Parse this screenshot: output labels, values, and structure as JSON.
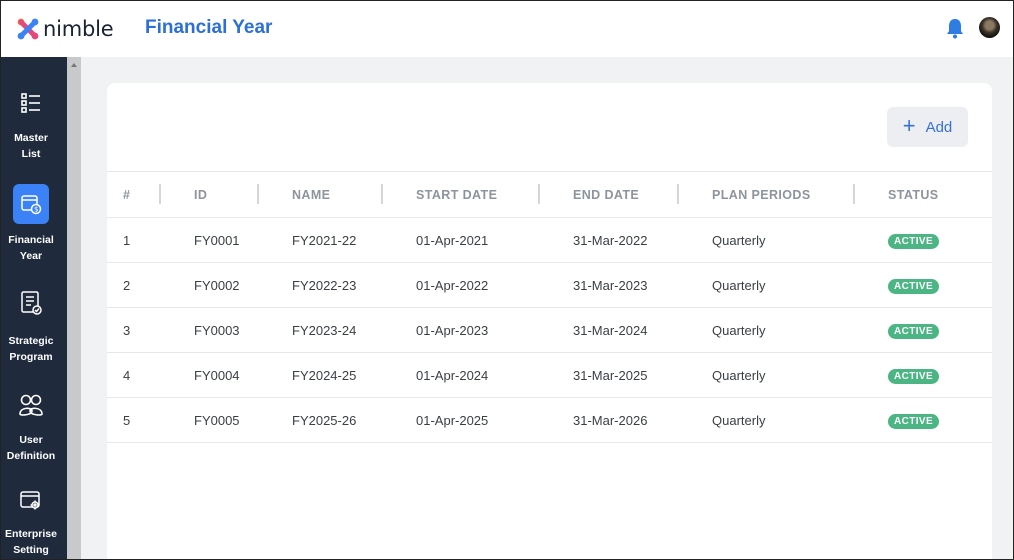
{
  "app": {
    "logo_text": "nimble",
    "page_title": "Financial Year"
  },
  "colors": {
    "accent": "#2c6fd8",
    "sidebar_bg": "#1f2a3d",
    "active_nav": "#3b82f6",
    "status_active": "#4bb584"
  },
  "sidebar": {
    "items": [
      {
        "label_line1": "Master",
        "label_line2": "List",
        "icon": "list-icon"
      },
      {
        "label_line1": "Financial",
        "label_line2": "Year",
        "icon": "calendar-dollar-icon",
        "active": true
      },
      {
        "label_line1": "Strategic",
        "label_line2": "Program",
        "icon": "checklist-icon"
      },
      {
        "label_line1": "User",
        "label_line2": "Definition",
        "icon": "users-icon"
      },
      {
        "label_line1": "Enterprise",
        "label_line2": "Setting",
        "icon": "window-gear-icon"
      }
    ]
  },
  "toolbar": {
    "add_label": "Add"
  },
  "table": {
    "columns": [
      "#",
      "ID",
      "NAME",
      "START DATE",
      "END DATE",
      "PLAN PERIODS",
      "STATUS"
    ],
    "rows": [
      [
        "1",
        "FY0001",
        "FY2021-22",
        "01-Apr-2021",
        "31-Mar-2022",
        "Quarterly",
        "ACTIVE"
      ],
      [
        "2",
        "FY0002",
        "FY2022-23",
        "01-Apr-2022",
        "31-Mar-2023",
        "Quarterly",
        "ACTIVE"
      ],
      [
        "3",
        "FY0003",
        "FY2023-24",
        "01-Apr-2023",
        "31-Mar-2024",
        "Quarterly",
        "ACTIVE"
      ],
      [
        "4",
        "FY0004",
        "FY2024-25",
        "01-Apr-2024",
        "31-Mar-2025",
        "Quarterly",
        "ACTIVE"
      ],
      [
        "5",
        "FY0005",
        "FY2025-26",
        "01-Apr-2025",
        "31-Mar-2026",
        "Quarterly",
        "ACTIVE"
      ]
    ]
  }
}
